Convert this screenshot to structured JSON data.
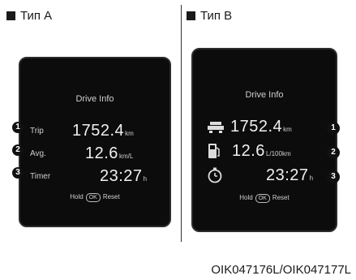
{
  "type_a": {
    "header": "Тип A",
    "title": "Drive Info",
    "rows": [
      {
        "marker": "1",
        "label": "Trip",
        "value": "1752.4",
        "unit": "km"
      },
      {
        "marker": "2",
        "label": "Avg.",
        "value": "12.6",
        "unit": "km/L"
      },
      {
        "marker": "3",
        "label": "Timer",
        "value": "23:27",
        "unit": "h"
      }
    ],
    "hold_text": "Hold",
    "ok_text": "OK",
    "reset_text": "Reset"
  },
  "type_b": {
    "header": "Тип B",
    "title": "Drive Info",
    "rows": [
      {
        "marker": "1",
        "icon": "car-trip-icon",
        "value": "1752.4",
        "unit": "km"
      },
      {
        "marker": "2",
        "icon": "fuel-pump-icon",
        "value": "12.6",
        "unit": "L/100km"
      },
      {
        "marker": "3",
        "icon": "stopwatch-icon",
        "value": "23:27",
        "unit": "h"
      }
    ],
    "hold_text": "Hold",
    "ok_text": "OK",
    "reset_text": "Reset"
  },
  "caption": "OIK047176L/OIK047177L"
}
